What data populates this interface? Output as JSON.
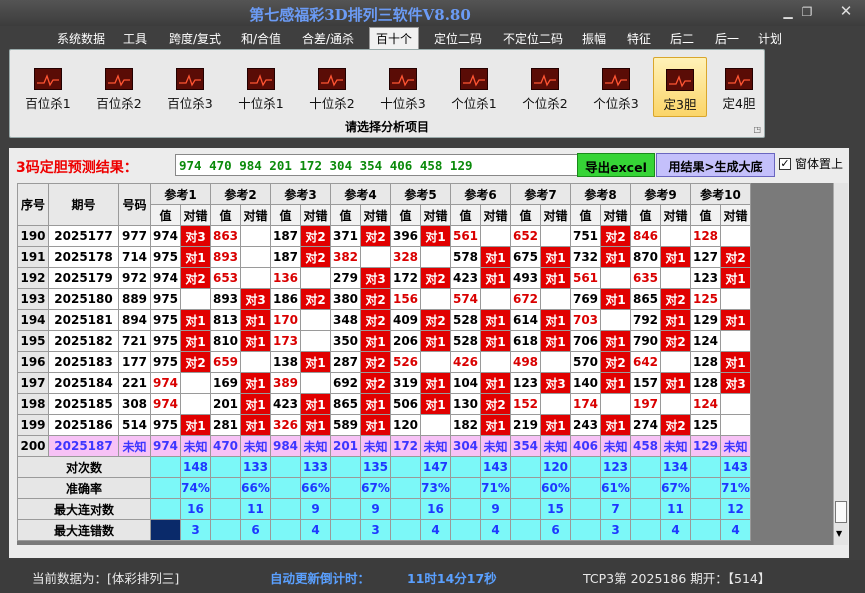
{
  "window": {
    "title": "第七感福彩3D排列三软件V8.80"
  },
  "menu": [
    "系统数据",
    "工具",
    "跨度/复式",
    "和/合值",
    "合差/通杀",
    "百十个",
    "定位二码",
    "不定位二码",
    "振幅",
    "特征",
    "后二",
    "后一",
    "计划"
  ],
  "menu_active": 5,
  "ribbon": {
    "buttons": [
      "百位杀1",
      "百位杀2",
      "百位杀3",
      "十位杀1",
      "十位杀2",
      "十位杀3",
      "个位杀1",
      "个位杀2",
      "个位杀3",
      "定3胆",
      "定4胆"
    ],
    "selected": 9,
    "caption": "请选择分析项目"
  },
  "prediction": {
    "label": "3码定胆预测结果：",
    "value": "974 470 984 201 172 304 354 406 458 129",
    "export_button": "导出excel",
    "generate_button": "用结果>生成大底",
    "topmost_checked": true,
    "topmost_label": "窗体置上"
  },
  "table": {
    "col_seq": "序号",
    "col_period": "期号",
    "col_number": "号码",
    "col_value": "值",
    "col_result": "对错",
    "refs": [
      "参考1",
      "参考2",
      "参考3",
      "参考4",
      "参考5",
      "参考6",
      "参考7",
      "参考8",
      "参考9",
      "参考10"
    ],
    "rows": [
      {
        "seq": "190",
        "period": "2025177",
        "num": "977",
        "vals": [
          "974",
          "863",
          "187",
          "371",
          "396",
          "561",
          "652",
          "751",
          "846",
          "128"
        ],
        "red": [
          0,
          1,
          0,
          0,
          0,
          1,
          1,
          0,
          1,
          1
        ],
        "res": [
          "对3",
          "",
          "对2",
          "对2",
          "对1",
          "",
          "",
          "对2",
          "",
          ""
        ]
      },
      {
        "seq": "191",
        "period": "2025178",
        "num": "714",
        "vals": [
          "975",
          "893",
          "187",
          "382",
          "328",
          "578",
          "675",
          "732",
          "870",
          "127"
        ],
        "red": [
          0,
          1,
          0,
          1,
          1,
          0,
          0,
          0,
          0,
          0
        ],
        "res": [
          "对1",
          "",
          "对2",
          "",
          "",
          "对1",
          "对1",
          "对1",
          "对1",
          "对2"
        ]
      },
      {
        "seq": "192",
        "period": "2025179",
        "num": "972",
        "vals": [
          "974",
          "653",
          "136",
          "279",
          "172",
          "423",
          "493",
          "561",
          "635",
          "123"
        ],
        "red": [
          0,
          1,
          1,
          0,
          0,
          0,
          0,
          1,
          1,
          0
        ],
        "res": [
          "对2",
          "",
          "",
          "对3",
          "对2",
          "对1",
          "对1",
          "",
          "",
          "对1"
        ]
      },
      {
        "seq": "193",
        "period": "2025180",
        "num": "889",
        "vals": [
          "975",
          "893",
          "186",
          "380",
          "156",
          "574",
          "672",
          "769",
          "865",
          "125"
        ],
        "red": [
          0,
          0,
          0,
          0,
          1,
          1,
          1,
          0,
          0,
          1
        ],
        "res": [
          "",
          "对3",
          "对2",
          "对2",
          "",
          "",
          "",
          "对1",
          "对2",
          ""
        ]
      },
      {
        "seq": "194",
        "period": "2025181",
        "num": "894",
        "vals": [
          "975",
          "813",
          "170",
          "348",
          "409",
          "528",
          "614",
          "703",
          "792",
          "129"
        ],
        "red": [
          0,
          0,
          1,
          0,
          0,
          0,
          0,
          1,
          0,
          0
        ],
        "res": [
          "对1",
          "对1",
          "",
          "对2",
          "对2",
          "对1",
          "对1",
          "",
          "对1",
          "对1"
        ]
      },
      {
        "seq": "195",
        "period": "2025182",
        "num": "721",
        "vals": [
          "975",
          "810",
          "350",
          "206",
          "528",
          "618",
          "706",
          "790",
          "124",
          ""
        ],
        "red": [
          0,
          0,
          1,
          0,
          0,
          0,
          0,
          0,
          0,
          0
        ],
        "res": [
          "对1",
          "对1",
          "",
          "对1",
          "对1",
          "对1",
          "对1",
          "对1",
          "对2",
          ""
        ],
        "v3": "173"
      },
      {
        "seq": "196",
        "period": "2025183",
        "num": "177",
        "vals": [
          "975",
          "659",
          "138",
          "287",
          "526",
          "426",
          "498",
          "570",
          "642",
          "128"
        ],
        "red": [
          0,
          1,
          0,
          0,
          1,
          1,
          1,
          0,
          1,
          0
        ],
        "res": [
          "对2",
          "",
          "对1",
          "对2",
          "",
          "",
          "",
          "对2",
          "",
          "对1"
        ]
      },
      {
        "seq": "197",
        "period": "2025184",
        "num": "221",
        "vals": [
          "974",
          "169",
          "389",
          "692",
          "319",
          "104",
          "123",
          "140",
          "157",
          "128"
        ],
        "red": [
          1,
          0,
          1,
          0,
          0,
          0,
          0,
          0,
          0,
          0
        ],
        "res": [
          "",
          "对1",
          "",
          "对2",
          "对1",
          "对1",
          "对3",
          "对1",
          "对1",
          "对3"
        ]
      },
      {
        "seq": "198",
        "period": "2025185",
        "num": "308",
        "vals": [
          "974",
          "201",
          "423",
          "865",
          "506",
          "130",
          "152",
          "174",
          "197",
          "124"
        ],
        "red": [
          1,
          0,
          0,
          0,
          0,
          0,
          1,
          1,
          1,
          1
        ],
        "res": [
          "",
          "对1",
          "对1",
          "对1",
          "对1",
          "对2",
          "",
          "",
          "",
          ""
        ]
      },
      {
        "seq": "199",
        "period": "2025186",
        "num": "514",
        "vals": [
          "975",
          "281",
          "589",
          "120",
          "182",
          "219",
          "243",
          "274",
          "125",
          ""
        ],
        "red": [
          0,
          0,
          0,
          0,
          0,
          0,
          0,
          0,
          0,
          0
        ],
        "res": [
          "对1",
          "对1",
          "对1",
          "对1",
          "",
          "对1",
          "对1",
          "对1",
          "对2",
          ""
        ],
        "v3": "326"
      },
      {
        "seq": "200",
        "period": "2025187",
        "num": "未知",
        "vals": [
          "974",
          "470",
          "984",
          "201",
          "172",
          "304",
          "354",
          "406",
          "458",
          "129"
        ],
        "res_label": "未知"
      }
    ],
    "stats": [
      {
        "label": "对次数",
        "vals": [
          "148",
          "133",
          "133",
          "135",
          "147",
          "143",
          "120",
          "123",
          "134",
          "143"
        ]
      },
      {
        "label": "准确率",
        "vals": [
          "74%",
          "66%",
          "66%",
          "67%",
          "73%",
          "71%",
          "60%",
          "61%",
          "67%",
          "71%"
        ]
      },
      {
        "label": "最大连对数",
        "vals": [
          "16",
          "11",
          "9",
          "9",
          "16",
          "9",
          "15",
          "7",
          "11",
          "12"
        ]
      },
      {
        "label": "最大连错数",
        "vals": [
          "3",
          "6",
          "4",
          "3",
          "4",
          "4",
          "6",
          "3",
          "4",
          "4"
        ]
      }
    ]
  },
  "status": {
    "current_data": "当前数据为：[体彩排列三]",
    "countdown_label": "自动更新倒计时：",
    "countdown_value": "11时14分17秒",
    "last_draw": "TCP3第 2025186 期开：【514】"
  },
  "colors": {
    "accent_title": "#6b9bf5",
    "miss_red": "#e10000",
    "predict_row": "#f7c2f6",
    "stats_cyan": "#7cf8f8"
  }
}
